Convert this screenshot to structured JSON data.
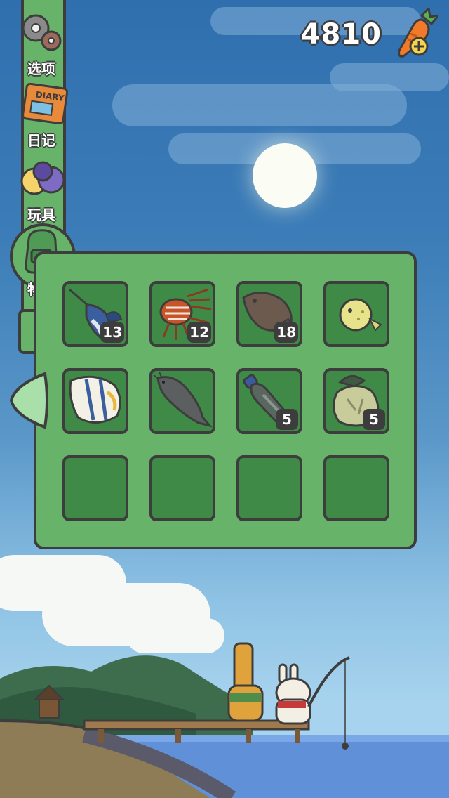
{
  "header": {
    "carrot_count": "4810"
  },
  "icons": {
    "currency": "carrot-icon",
    "add": "plus-icon"
  },
  "side_menu": {
    "items": [
      {
        "label": "选项",
        "icon": "gear-icon"
      },
      {
        "label": "日记",
        "icon": "diary-icon",
        "icon_text": "DIARY"
      },
      {
        "label": "玩具",
        "icon": "toy-balls-icon"
      },
      {
        "label": "物品",
        "icon": "backpack-icon",
        "active": true
      }
    ]
  },
  "inventory": {
    "slots": [
      {
        "item": "swordfish",
        "count": "13"
      },
      {
        "item": "lionfish",
        "count": "12"
      },
      {
        "item": "flounder",
        "count": "18"
      },
      {
        "item": "pufferfish",
        "count": ""
      },
      {
        "item": "butterflyfish",
        "count": ""
      },
      {
        "item": "catfish",
        "count": ""
      },
      {
        "item": "plastic-bottle",
        "count": "5"
      },
      {
        "item": "trash-bag",
        "count": "5"
      },
      {
        "item": "",
        "count": ""
      },
      {
        "item": "",
        "count": ""
      },
      {
        "item": "",
        "count": ""
      },
      {
        "item": "",
        "count": ""
      }
    ]
  },
  "colors": {
    "panel_green": "#67b36a",
    "slot_green": "#3f8a47",
    "outline": "#3d3d3d",
    "sky": "#3c7db8"
  }
}
